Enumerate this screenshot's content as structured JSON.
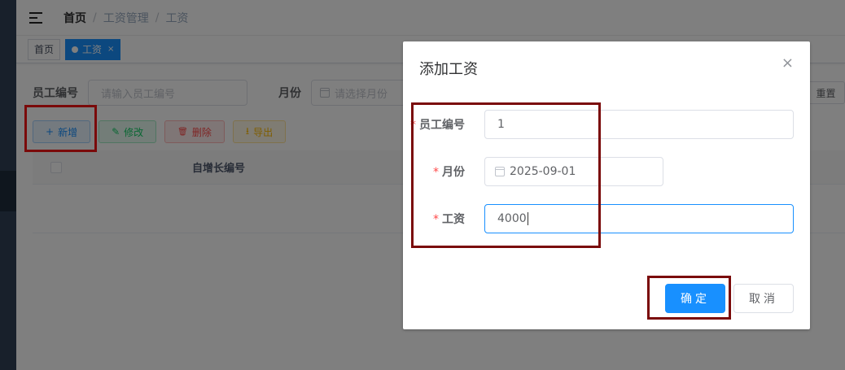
{
  "navbar": {
    "breadcrumb": [
      "首页",
      "工资管理",
      "工资"
    ],
    "separator": "/"
  },
  "tags": [
    {
      "label": "首页"
    },
    {
      "label": "工资",
      "close": "×"
    }
  ],
  "search": {
    "employee_id_label": "员工编号",
    "employee_id_placeholder": "请输入员工编号",
    "month_label": "月份",
    "month_placeholder": "请选择月份",
    "reset_label": "重置"
  },
  "toolbar": {
    "add_label": "新增",
    "edit_label": "修改",
    "delete_label": "删除",
    "export_label": "导出",
    "add_icon": "+",
    "edit_icon": "✎",
    "delete_icon": "🗑",
    "export_icon": "⭳"
  },
  "table": {
    "columns": [
      "自增长编号"
    ]
  },
  "dialog": {
    "title": "添加工资",
    "close_icon": "×",
    "required_mark": "*",
    "fields": {
      "employee_id": {
        "label": "员工编号",
        "value": "1"
      },
      "month": {
        "label": "月份",
        "value": "2025-09-01"
      },
      "salary": {
        "label": "工资",
        "value": "4000"
      }
    },
    "ok_label": "确定",
    "cancel_label": "取消"
  },
  "colors": {
    "primary": "#1890ff",
    "annotation_red": "#7a0a0a",
    "sidebar": "#304156"
  }
}
